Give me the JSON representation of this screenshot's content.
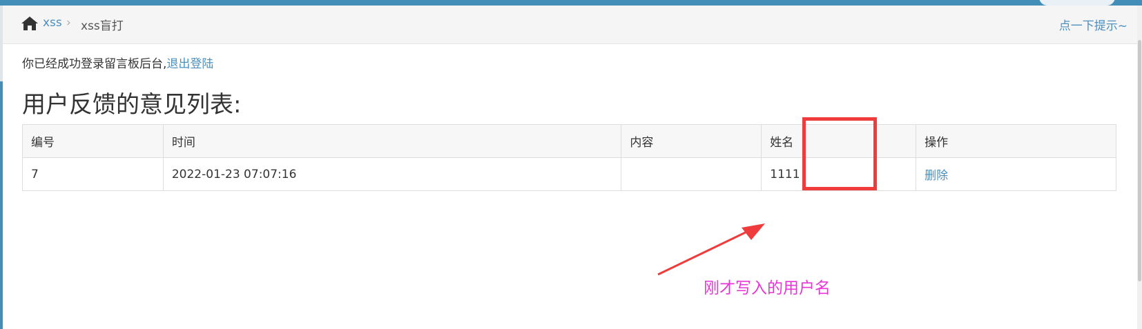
{
  "breadcrumb": {
    "home_icon": "home-icon",
    "link_label": "xss",
    "separator": "›",
    "current": "xss盲打"
  },
  "hint_link": "点一下提示~",
  "login": {
    "message": "你已经成功登录留言板后台,",
    "logout_link": "退出登陆"
  },
  "page_title": "用户反馈的意见列表:",
  "table": {
    "headers": [
      "编号",
      "时间",
      "内容",
      "姓名",
      "操作"
    ],
    "rows": [
      {
        "id": "7",
        "time": "2022-01-23 07:07:16",
        "content": "",
        "name": "1111",
        "action": "删除"
      }
    ]
  },
  "annotation": {
    "text": "刚才写入的用户名",
    "color": "#e935d8",
    "box_color": "#ef3b3b"
  },
  "colors": {
    "accent": "#438eb9",
    "link": "#4c8fbd"
  }
}
